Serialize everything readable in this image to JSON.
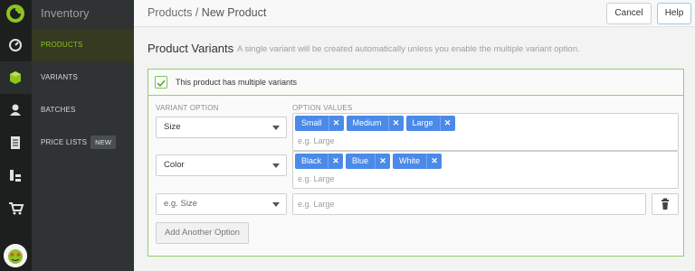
{
  "app": {
    "brand": "Inventory"
  },
  "nav": {
    "items": [
      {
        "label": "PRODUCTS"
      },
      {
        "label": "VARIANTS"
      },
      {
        "label": "BATCHES"
      },
      {
        "label": "PRICE LISTS",
        "badge": "NEW"
      }
    ]
  },
  "header": {
    "breadcrumb_parent": "Products",
    "breadcrumb_sep": "/",
    "breadcrumb_current": "New Product",
    "cancel_label": "Cancel",
    "help_label": "Help"
  },
  "section": {
    "title": "Product Variants",
    "subtitle": "A single variant will be created automatically unless you enable the multiple variant option."
  },
  "multiple_variants": {
    "checked": true,
    "label": "This product has multiple variants"
  },
  "columns": {
    "option": "VARIANT OPTION",
    "values": "OPTION VALUES"
  },
  "options": [
    {
      "name": "Size",
      "values": [
        "Small",
        "Medium",
        "Large"
      ],
      "values_placeholder": "e.g. Large"
    },
    {
      "name": "Color",
      "values": [
        "Black",
        "Blue",
        "White"
      ],
      "values_placeholder": "e.g. Large"
    }
  ],
  "new_option": {
    "name_placeholder": "e.g. Size",
    "values_placeholder": "e.g. Large"
  },
  "add_option_label": "Add Another Option",
  "colors": {
    "accent_green": "#8fc31f",
    "tag_blue": "#4b8ae8",
    "panel_border": "#8fd06a"
  },
  "icons": [
    "logo-icon",
    "dashboard-icon",
    "box-icon",
    "user-icon",
    "document-icon",
    "hierarchy-icon",
    "cart-icon",
    "tag-remove-icon",
    "trash-icon",
    "checkmark-icon"
  ]
}
